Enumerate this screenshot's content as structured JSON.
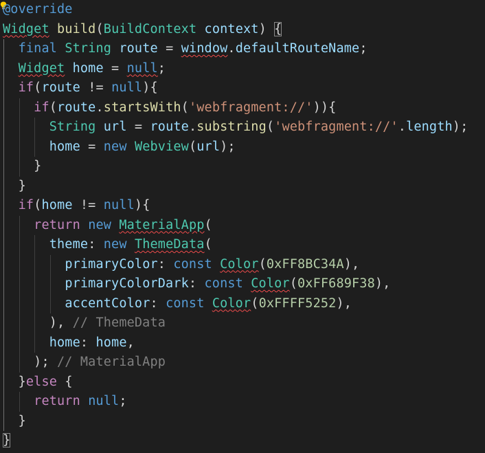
{
  "colors": {
    "background": "#1e1e1e",
    "default": "#d4d4d4",
    "keyword": "#569cd6",
    "control": "#c586c0",
    "type": "#4ec9b0",
    "function": "#dcdcaa",
    "variable": "#9cdcfe",
    "string": "#ce9178",
    "number": "#b5cea8",
    "comment": "#6a9955",
    "muted_comment": "#808080",
    "error_squiggle": "#f14c4c",
    "indent_guide": "#404040",
    "indent_guide_active": "#707070"
  },
  "icons": {
    "quick_fix": "lightbulb-icon"
  },
  "code": [
    [
      {
        "t": "@override",
        "c": "keyword"
      }
    ],
    [
      {
        "t": "Widget",
        "c": "type",
        "sq": true
      },
      {
        "t": " "
      },
      {
        "t": "build",
        "c": "function"
      },
      {
        "t": "("
      },
      {
        "t": "BuildContext",
        "c": "type"
      },
      {
        "t": " "
      },
      {
        "t": "context",
        "c": "variable"
      },
      {
        "t": ") "
      },
      {
        "t": "{",
        "bracket": true
      }
    ],
    [
      {
        "t": "  "
      },
      {
        "t": "final",
        "c": "keyword"
      },
      {
        "t": " "
      },
      {
        "t": "String",
        "c": "type"
      },
      {
        "t": " "
      },
      {
        "t": "route",
        "c": "variable"
      },
      {
        "t": " = "
      },
      {
        "t": "window",
        "c": "variable",
        "sq": true
      },
      {
        "t": "."
      },
      {
        "t": "defaultRouteName",
        "c": "variable"
      },
      {
        "t": ";"
      }
    ],
    [
      {
        "t": "  "
      },
      {
        "t": "Widget",
        "c": "type",
        "sq": true
      },
      {
        "t": " "
      },
      {
        "t": "home",
        "c": "variable"
      },
      {
        "t": " = "
      },
      {
        "t": "null",
        "c": "keyword",
        "sq": true
      },
      {
        "t": ";"
      }
    ],
    [
      {
        "t": "  "
      },
      {
        "t": "if",
        "c": "control"
      },
      {
        "t": "("
      },
      {
        "t": "route",
        "c": "variable"
      },
      {
        "t": " != "
      },
      {
        "t": "null",
        "c": "keyword"
      },
      {
        "t": "){"
      }
    ],
    [
      {
        "t": "    "
      },
      {
        "t": "if",
        "c": "control"
      },
      {
        "t": "("
      },
      {
        "t": "route",
        "c": "variable"
      },
      {
        "t": "."
      },
      {
        "t": "startsWith",
        "c": "function"
      },
      {
        "t": "("
      },
      {
        "t": "'webfragment://'",
        "c": "string"
      },
      {
        "t": ")){"
      }
    ],
    [
      {
        "t": "      "
      },
      {
        "t": "String",
        "c": "type"
      },
      {
        "t": " "
      },
      {
        "t": "url",
        "c": "variable"
      },
      {
        "t": " = "
      },
      {
        "t": "route",
        "c": "variable"
      },
      {
        "t": "."
      },
      {
        "t": "substring",
        "c": "function"
      },
      {
        "t": "("
      },
      {
        "t": "'webfragment://'",
        "c": "string"
      },
      {
        "t": "."
      },
      {
        "t": "length",
        "c": "variable"
      },
      {
        "t": ");"
      }
    ],
    [
      {
        "t": "      "
      },
      {
        "t": "home",
        "c": "variable"
      },
      {
        "t": " = "
      },
      {
        "t": "new",
        "c": "keyword"
      },
      {
        "t": " "
      },
      {
        "t": "Webview",
        "c": "type"
      },
      {
        "t": "("
      },
      {
        "t": "url",
        "c": "variable"
      },
      {
        "t": ");"
      }
    ],
    [
      {
        "t": "    }"
      }
    ],
    [
      {
        "t": "  }"
      }
    ],
    [
      {
        "t": "  "
      },
      {
        "t": "if",
        "c": "control"
      },
      {
        "t": "("
      },
      {
        "t": "home",
        "c": "variable"
      },
      {
        "t": " != "
      },
      {
        "t": "null",
        "c": "keyword"
      },
      {
        "t": "){"
      }
    ],
    [
      {
        "t": "    "
      },
      {
        "t": "return",
        "c": "control"
      },
      {
        "t": " "
      },
      {
        "t": "new",
        "c": "keyword"
      },
      {
        "t": " "
      },
      {
        "t": "MaterialApp",
        "c": "type",
        "sq": true
      },
      {
        "t": "("
      }
    ],
    [
      {
        "t": "      "
      },
      {
        "t": "theme",
        "c": "variable"
      },
      {
        "t": ": "
      },
      {
        "t": "new",
        "c": "keyword"
      },
      {
        "t": " "
      },
      {
        "t": "ThemeData",
        "c": "type",
        "sq": true
      },
      {
        "t": "("
      }
    ],
    [
      {
        "t": "        "
      },
      {
        "t": "primaryColor",
        "c": "variable"
      },
      {
        "t": ": "
      },
      {
        "t": "const",
        "c": "keyword"
      },
      {
        "t": " "
      },
      {
        "t": "Color",
        "c": "type",
        "sq": true
      },
      {
        "t": "("
      },
      {
        "t": "0xFF8BC34A",
        "c": "number"
      },
      {
        "t": "),"
      }
    ],
    [
      {
        "t": "        "
      },
      {
        "t": "primaryColorDark",
        "c": "variable"
      },
      {
        "t": ": "
      },
      {
        "t": "const",
        "c": "keyword"
      },
      {
        "t": " "
      },
      {
        "t": "Color",
        "c": "type",
        "sq": true
      },
      {
        "t": "("
      },
      {
        "t": "0xFF689F38",
        "c": "number"
      },
      {
        "t": "),"
      }
    ],
    [
      {
        "t": "        "
      },
      {
        "t": "accentColor",
        "c": "variable"
      },
      {
        "t": ": "
      },
      {
        "t": "const",
        "c": "keyword"
      },
      {
        "t": " "
      },
      {
        "t": "Color",
        "c": "type",
        "sq": true
      },
      {
        "t": "("
      },
      {
        "t": "0xFFFF5252",
        "c": "number"
      },
      {
        "t": "),"
      }
    ],
    [
      {
        "t": "      ), "
      },
      {
        "t": "// ThemeData",
        "c": "muted_comment"
      }
    ],
    [
      {
        "t": "      "
      },
      {
        "t": "home",
        "c": "variable"
      },
      {
        "t": ": "
      },
      {
        "t": "home",
        "c": "variable"
      },
      {
        "t": ","
      }
    ],
    [
      {
        "t": "    ); "
      },
      {
        "t": "// MaterialApp",
        "c": "muted_comment"
      }
    ],
    [
      {
        "t": "  }"
      },
      {
        "t": "else",
        "c": "control"
      },
      {
        "t": " {"
      }
    ],
    [
      {
        "t": "    "
      },
      {
        "t": "return",
        "c": "control"
      },
      {
        "t": " "
      },
      {
        "t": "null",
        "c": "keyword"
      },
      {
        "t": ";"
      }
    ],
    [
      {
        "t": "  }"
      }
    ],
    [
      {
        "t": "}",
        "bracket": true
      }
    ]
  ]
}
